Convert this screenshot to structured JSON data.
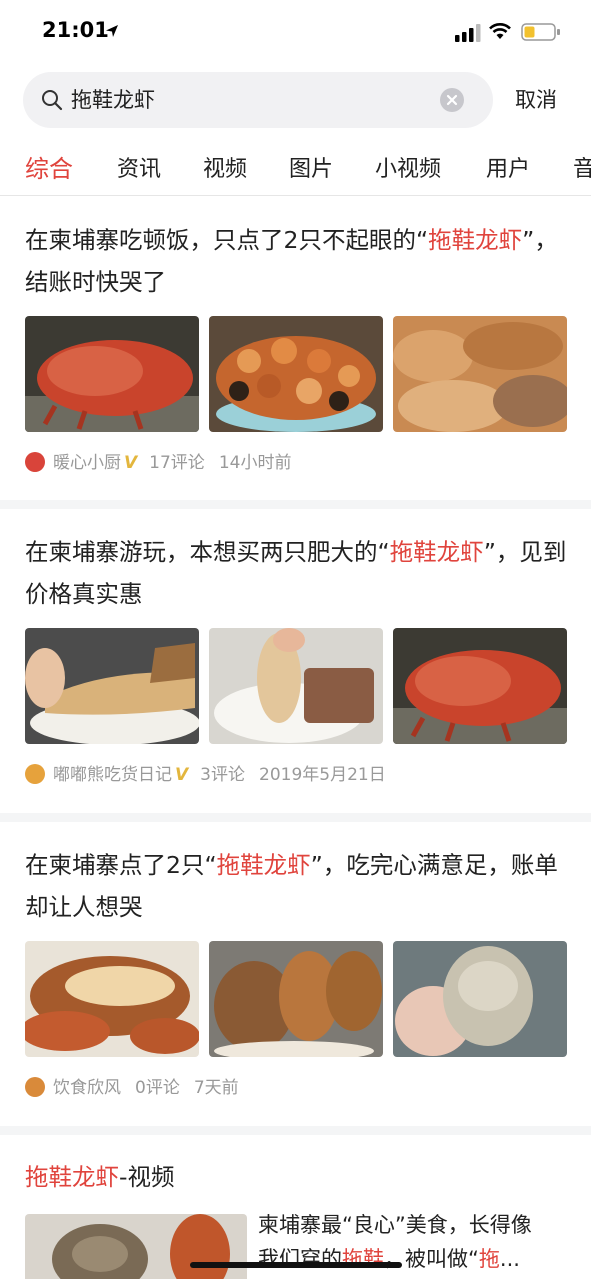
{
  "status_bar": {
    "time": "21:01"
  },
  "search": {
    "query": "拖鞋龙虾",
    "cancel_label": "取消"
  },
  "tabs": [
    {
      "label": "综合",
      "active": true
    },
    {
      "label": "资讯"
    },
    {
      "label": "视频"
    },
    {
      "label": "图片"
    },
    {
      "label": "小视频"
    },
    {
      "label": "用户"
    },
    {
      "label": "音"
    }
  ],
  "articles": [
    {
      "title_pre": "在柬埔寨吃顿饭，只点了2只不起眼的“",
      "title_hl": "拖鞋龙虾",
      "title_post": "”，结账时快哭了",
      "author": "暖心小厨",
      "verified": "V",
      "comments": "17评论",
      "time": "14小时前",
      "images": [
        "red-slipper-lobster-photo",
        "cooked-crayfish-plate-photo",
        "raw-slipper-lobsters-pile-photo"
      ]
    },
    {
      "title_pre": "在柬埔寨游玩，本想买两只肥大的“",
      "title_hl": "拖鞋龙虾",
      "title_post": "”，见到价格真实惠",
      "author": "嘟嘟熊吃货日记",
      "verified": "V",
      "comments": "3评论",
      "time": "2019年5月21日",
      "images": [
        "lobster-meat-on-plate-photo",
        "hand-opening-lobster-photo",
        "red-slipper-lobster-photo"
      ]
    },
    {
      "title_pre": "在柬埔寨点了2只“",
      "title_hl": "拖鞋龙虾",
      "title_post": "”，吃完心满意足，账单却让人想哭",
      "author": "饮食欣风",
      "verified": "",
      "comments": "0评论",
      "time": "7天前",
      "images": [
        "grilled-lobster-photo",
        "cooked-slipper-lobsters-photo",
        "raw-lobster-in-hand-photo"
      ]
    }
  ],
  "video_section": {
    "heading_hl": "拖鞋龙虾",
    "heading_rest": "-视频",
    "video_title_1": "柬埔寨最“良心”美食，长得像",
    "video_title_2_pre": "我们穿的",
    "video_title_2_hl": "拖鞋",
    "video_title_2_mid": "，被叫做“",
    "video_title_2_hl2": "拖",
    "video_title_2_end": "..."
  },
  "colors": {
    "accent": "#e0443d",
    "meta": "#999999",
    "verified": "#e3b63d"
  }
}
